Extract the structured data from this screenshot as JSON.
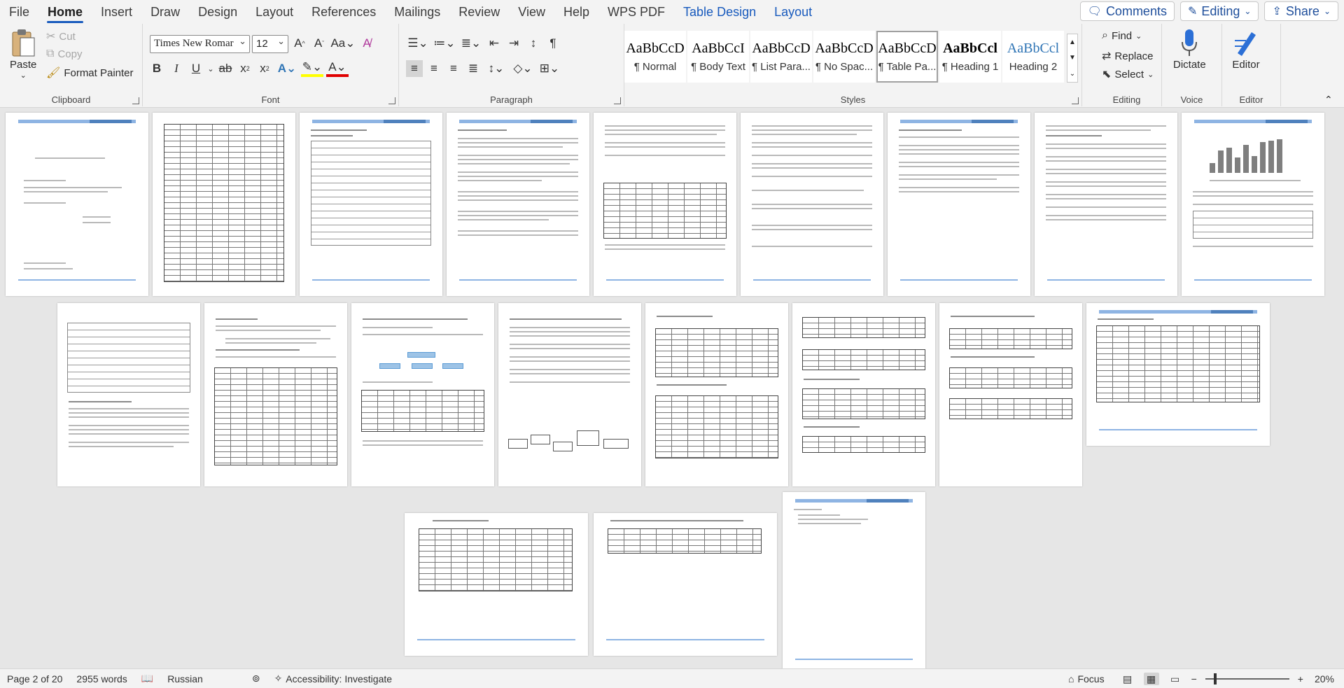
{
  "menu": {
    "tabs": [
      {
        "label": "File"
      },
      {
        "label": "Home"
      },
      {
        "label": "Insert"
      },
      {
        "label": "Draw"
      },
      {
        "label": "Design"
      },
      {
        "label": "Layout"
      },
      {
        "label": "References"
      },
      {
        "label": "Mailings"
      },
      {
        "label": "Review"
      },
      {
        "label": "View"
      },
      {
        "label": "Help"
      },
      {
        "label": "WPS PDF"
      },
      {
        "label": "Table Design"
      },
      {
        "label": "Layout"
      }
    ],
    "comments": "Comments",
    "editing": "Editing",
    "share": "Share"
  },
  "ribbon": {
    "clipboard": {
      "label": "Clipboard",
      "paste": "Paste",
      "cut": "Cut",
      "copy": "Copy",
      "format_painter": "Format Painter"
    },
    "font": {
      "label": "Font",
      "family": "Times New Romar",
      "size": "12"
    },
    "paragraph": {
      "label": "Paragraph"
    },
    "styles": {
      "label": "Styles",
      "items": [
        {
          "preview": "AaBbCcD",
          "name": "¶ Normal"
        },
        {
          "preview": "AaBbCcI",
          "name": "¶ Body Text"
        },
        {
          "preview": "AaBbCcD",
          "name": "¶ List Para..."
        },
        {
          "preview": "AaBbCcD",
          "name": "¶ No Spac..."
        },
        {
          "preview": "AaBbCcD",
          "name": "¶ Table Pa..."
        },
        {
          "preview": "AaBbCcl",
          "name": "¶ Heading 1"
        },
        {
          "preview": "AaBbCcl",
          "name": "Heading 2"
        }
      ]
    },
    "editing": {
      "label": "Editing",
      "find": "Find",
      "replace": "Replace",
      "select": "Select"
    },
    "voice": {
      "label": "Voice",
      "dictate": "Dictate"
    },
    "editor": {
      "label": "Editor",
      "editor": "Editor"
    }
  },
  "status": {
    "page": "Page 2 of 20",
    "words": "2955 words",
    "language": "Russian",
    "accessibility": "Accessibility: Investigate",
    "focus": "Focus",
    "zoom": "20%"
  }
}
